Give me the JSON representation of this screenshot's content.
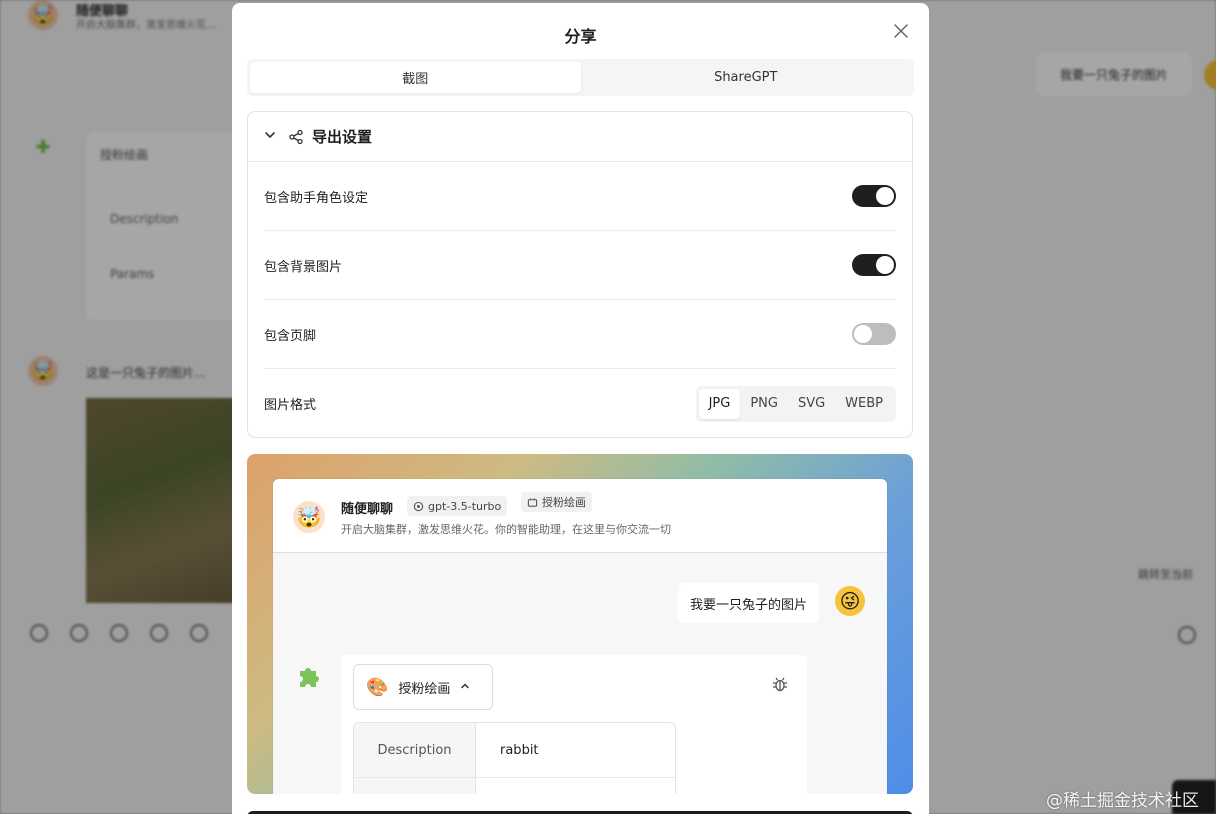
{
  "background": {
    "chat_title": "随便聊聊",
    "chat_sub": "开启大脑集群，激发思维火花…",
    "user_bubble": "我要一只兔子的图片",
    "plugin_name": "授粉绘画",
    "plugin_rows": [
      "Description",
      "Params"
    ],
    "assistant_text": "这是一只兔子的图片…",
    "right_link": "跳转至当前"
  },
  "modal": {
    "title": "分享",
    "close_icon": "close-icon",
    "tabs": [
      {
        "label": "截图",
        "active": true
      },
      {
        "label": "ShareGPT",
        "active": false
      }
    ],
    "settings": {
      "title": "导出设置",
      "rows": [
        {
          "label": "包含助手角色设定",
          "enabled": true
        },
        {
          "label": "包含背景图片",
          "enabled": true
        },
        {
          "label": "包含页脚",
          "enabled": false
        }
      ],
      "format": {
        "label": "图片格式",
        "options": [
          "JPG",
          "PNG",
          "SVG",
          "WEBP"
        ],
        "selected": "JPG"
      }
    },
    "preview": {
      "assistant_name": "随便聊聊",
      "model_tag": "gpt-3.5-turbo",
      "plugin_tag": "授粉绘画",
      "description": "开启大脑集群，激发思维火花。你的智能助理，在这里与你交流一切",
      "user_message": "我要一只兔子的图片",
      "plugin": {
        "name": "授粉绘画",
        "params": [
          {
            "key": "Description",
            "value": "rabbit"
          },
          {
            "key": "",
            "value": ""
          }
        ]
      }
    }
  },
  "watermark": "@稀土掘金技术社区",
  "colors": {
    "switch_on": "#1f1f1f",
    "switch_off": "#bdbdbd",
    "preview_gradient_start": "#dda16a",
    "preview_gradient_end": "#4e8ee8"
  }
}
